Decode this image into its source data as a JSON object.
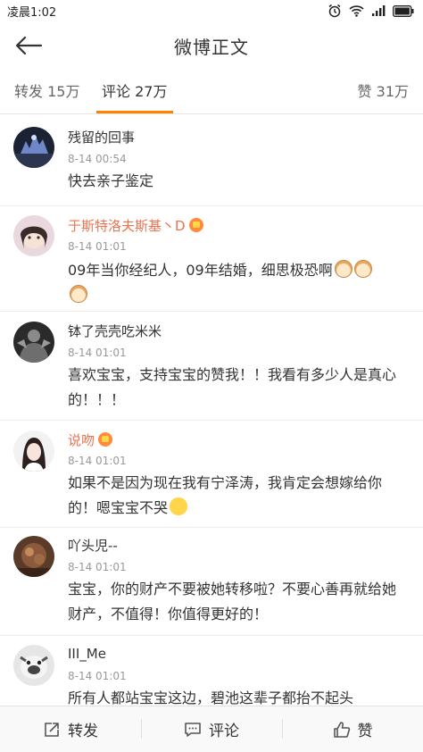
{
  "status_bar": {
    "time": "凌晨1:02"
  },
  "nav": {
    "title": "微博正文"
  },
  "tabs": {
    "repost": "转发 15万",
    "comment": "评论 27万",
    "like": "赞 31万",
    "active": "comment",
    "accent_color": "#ff8200"
  },
  "comments": [
    {
      "username": "残留的回事",
      "time": "8-14 00:54",
      "text": "快去亲子鉴定",
      "name_color": "#333333"
    },
    {
      "username": "于斯特洛夫斯基丶D",
      "time": "8-14 01:01",
      "text": "09年当你经纪人，09年结婚，细思极恐啊",
      "name_color": "#eb7350",
      "badge": "vip-badge",
      "emojis": [
        "cat-emoji",
        "cat-emoji",
        "cat-emoji"
      ]
    },
    {
      "username": "钵了壳壳吃米米",
      "time": "8-14 01:01",
      "text": "喜欢宝宝，支持宝宝的赞我！！我看有多少人是真心的！！！",
      "name_color": "#333333"
    },
    {
      "username": "说吻",
      "time": "8-14 01:01",
      "text": "如果不是因为现在我有宁泽涛，我肯定会想嫁给你的！嗯宝宝不哭",
      "name_color": "#eb7350",
      "badge": "vip-badge",
      "emojis": [
        "smile-emoji"
      ]
    },
    {
      "username": "吖头児--",
      "time": "8-14 01:01",
      "text": "宝宝，你的财产不要被她转移啦？不要心善再就给她财产，不值得！你值得更好的！",
      "name_color": "#333333"
    },
    {
      "username": "III_Me",
      "time": "8-14 01:01",
      "text": "所有人都站宝宝这边，碧池这辈子都抬不起头",
      "name_color": "#333333"
    }
  ],
  "bottom_bar": {
    "repost": "转发",
    "comment": "评论",
    "like": "赞"
  }
}
